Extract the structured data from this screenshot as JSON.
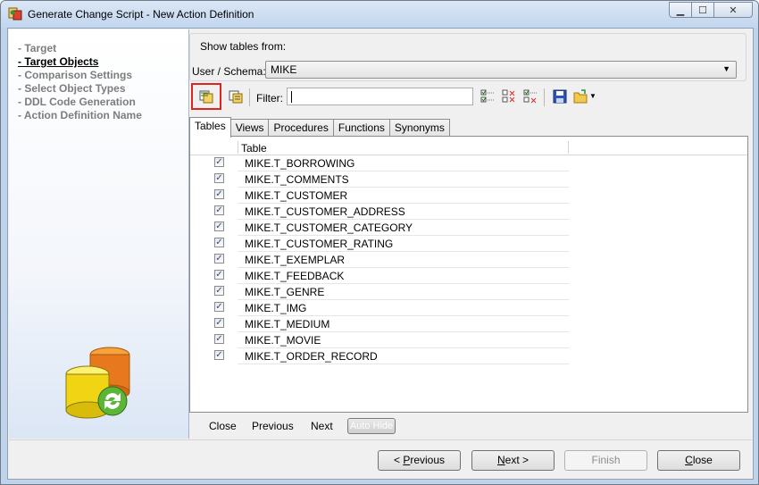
{
  "window": {
    "title": "Generate Change Script - New Action Definition"
  },
  "nav": {
    "items": [
      {
        "label": "- Target",
        "active": false
      },
      {
        "label": "- Target Objects",
        "active": true
      },
      {
        "label": "- Comparison Settings",
        "active": false
      },
      {
        "label": "- Select Object Types",
        "active": false
      },
      {
        "label": "- DDL Code Generation",
        "active": false
      },
      {
        "label": "- Action Definition Name",
        "active": false
      }
    ]
  },
  "source": {
    "group_label": "Show tables from:",
    "schema_label": "User / Schema:",
    "schema_value": "MIKE"
  },
  "toolbar": {
    "filter_label": "Filter:",
    "filter_value": ""
  },
  "tabs": [
    {
      "label": "Tables",
      "active": true
    },
    {
      "label": "Views",
      "active": false
    },
    {
      "label": "Procedures",
      "active": false
    },
    {
      "label": "Functions",
      "active": false
    },
    {
      "label": "Synonyms",
      "active": false
    }
  ],
  "grid": {
    "column": "Table",
    "rows": [
      {
        "name": "MIKE.T_BORROWING",
        "checked": true
      },
      {
        "name": "MIKE.T_COMMENTS",
        "checked": true
      },
      {
        "name": "MIKE.T_CUSTOMER",
        "checked": true
      },
      {
        "name": "MIKE.T_CUSTOMER_ADDRESS",
        "checked": true
      },
      {
        "name": "MIKE.T_CUSTOMER_CATEGORY",
        "checked": true
      },
      {
        "name": "MIKE.T_CUSTOMER_RATING",
        "checked": true
      },
      {
        "name": "MIKE.T_EXEMPLAR",
        "checked": true
      },
      {
        "name": "MIKE.T_FEEDBACK",
        "checked": true
      },
      {
        "name": "MIKE.T_GENRE",
        "checked": true
      },
      {
        "name": "MIKE.T_IMG",
        "checked": true
      },
      {
        "name": "MIKE.T_MEDIUM",
        "checked": true
      },
      {
        "name": "MIKE.T_MOVIE",
        "checked": true
      },
      {
        "name": "MIKE.T_ORDER_RECORD",
        "checked": true
      }
    ]
  },
  "autohide": {
    "close": "Close",
    "previous": "Previous",
    "next": "Next",
    "auto_hide": "Auto Hide"
  },
  "buttons": {
    "previous_prefix": "< ",
    "previous_hotkey": "P",
    "previous_rest": "revious",
    "next_hotkey": "N",
    "next_rest": "ext >",
    "finish": "Finish",
    "close_hotkey": "C",
    "close_rest": "lose"
  }
}
